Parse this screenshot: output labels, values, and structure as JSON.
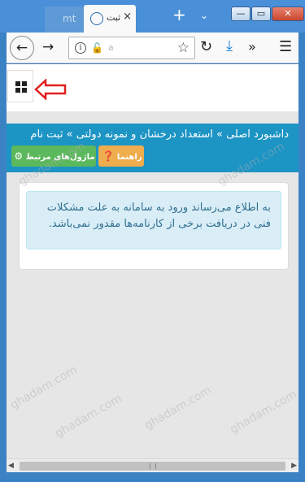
{
  "browser": {
    "inactive_tab_label": "mt",
    "active_tab_label": "ثبت",
    "tab_close": "×",
    "new_tab": "+",
    "tab_list": "⌄",
    "window_controls": [
      "—",
      "▭",
      "✕"
    ],
    "url_text": "a",
    "icons": [
      "back-icon",
      "forward-icon",
      "info-icon",
      "insecure-lock-icon",
      "star-icon",
      "reload-icon",
      "download-icon",
      "overflow-icon",
      "menu-icon"
    ]
  },
  "page": {
    "breadcrumb": "داشبورد اصلی » استعداد درخشان و نمونه دولتی » ثبت نام",
    "help_button": "راهنما",
    "related_modules_button": "ماژول‌های مرتبط",
    "alert_text": "به اطلاع می‌رساند ورود به سامانه به علت مشکلات فنی در دریافت برخی از کارنامه‌ها مقدور نمی‌باشد.",
    "watermark": "ghadam.com",
    "colors": {
      "header": "#1c94c4",
      "help_button": "#f0ad4e",
      "modules_button": "#5cb85c",
      "alert_bg": "#d9edf7",
      "alert_text": "#31708f",
      "annotation_arrow": "#e02020"
    }
  }
}
